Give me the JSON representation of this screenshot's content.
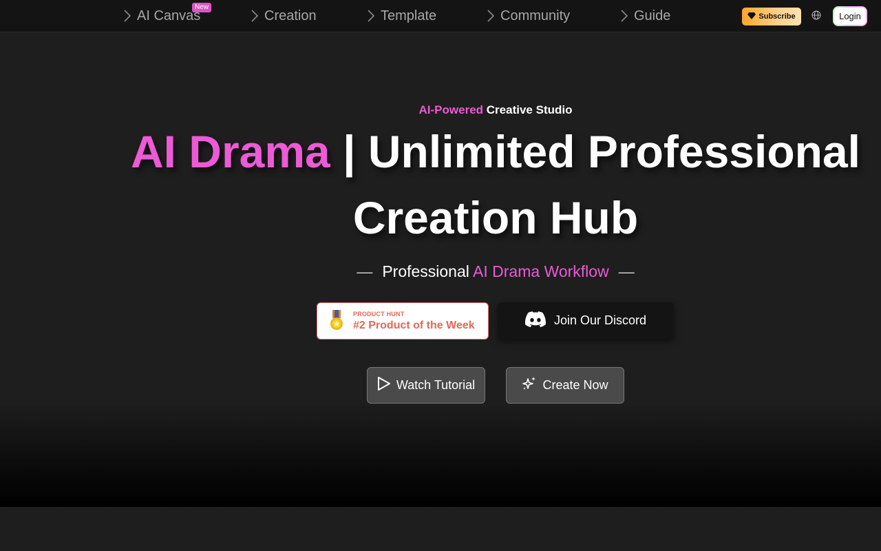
{
  "nav": {
    "items": [
      {
        "label": "AI Canvas",
        "badge": "New"
      },
      {
        "label": "Creation"
      },
      {
        "label": "Template"
      },
      {
        "label": "Community"
      },
      {
        "label": "Guide"
      }
    ],
    "subscribe_label": "Subscribe",
    "login_label": "Login"
  },
  "hero": {
    "tagline_highlight": "AI-Powered",
    "tagline_rest": "Creative Studio",
    "headline_highlight": "AI Drama",
    "headline_rest": "| Unlimited Professional",
    "headline_line2": "Creation Hub",
    "subline_prefix": "Professional",
    "subline_highlight": "AI Drama Workflow",
    "subline_dash": "—"
  },
  "product_hunt": {
    "small": "PRODUCT HUNT",
    "big": "#2 Product of the Week"
  },
  "discord": {
    "label": "Join Our Discord"
  },
  "cta": {
    "watch_label": "Watch Tutorial",
    "create_label": "Create Now"
  },
  "colors": {
    "accent_pink": "#ec5ad6",
    "subscribe_gradient_start": "#ffa62b",
    "product_hunt_red": "#e2675a"
  }
}
